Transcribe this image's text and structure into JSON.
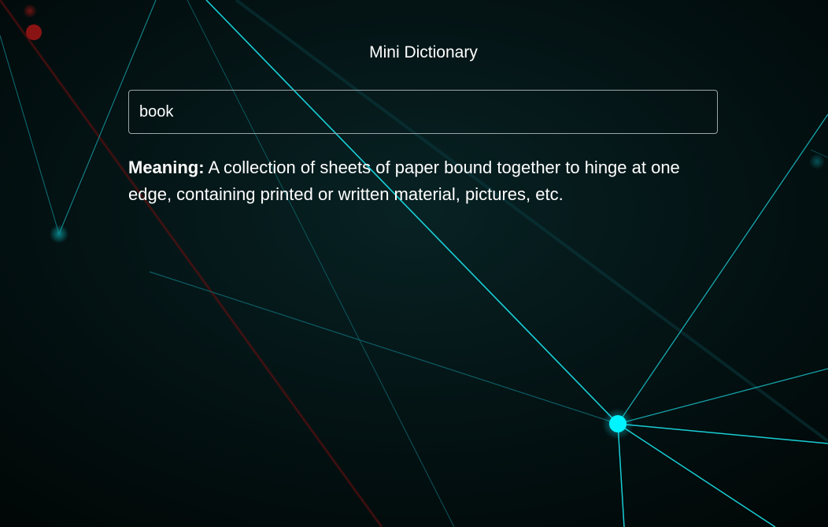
{
  "app": {
    "title": "Mini Dictionary"
  },
  "search": {
    "value": "book",
    "placeholder": ""
  },
  "result": {
    "label": "Meaning:",
    "text": "A collection of sheets of paper bound together to hinge at one edge, containing printed or written material, pictures, etc."
  },
  "colors": {
    "background": "#020c0d",
    "network_line": "#1ad8e0",
    "network_node": "#00f4ff",
    "red_line": "#7a1010",
    "text": "#ffffff"
  }
}
